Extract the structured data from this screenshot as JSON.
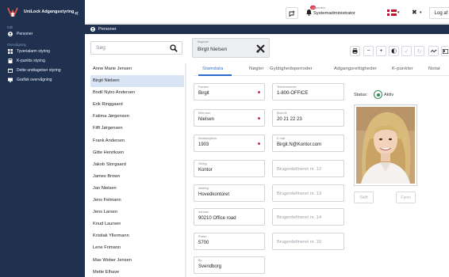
{
  "app": {
    "title": "UniLock Adgangsstyring"
  },
  "sidebar": {
    "section_edit": "Edit",
    "item_persons": "Personer",
    "section_overview": "Overvågning",
    "items": [
      {
        "label": "Tyverialarm styring",
        "icon": "grid-icon"
      },
      {
        "label": "K-punkts styring",
        "icon": "keypad-icon"
      },
      {
        "label": "Dette undtagelser styring",
        "icon": "calendar-icon"
      },
      {
        "label": "Grafisk overvågning",
        "icon": "monitor-icon"
      }
    ]
  },
  "topbar": {
    "notification_count": "16",
    "user_role": "Operator",
    "user_name": "Systemadministrator",
    "logout_label": "Log af"
  },
  "section": {
    "title": "Personer"
  },
  "list": {
    "search_placeholder": "Søg",
    "persons": [
      "Anne Marie Jensen",
      "Birgit Nielsen",
      "Bodil Nybo Andersen",
      "Erik Ringgaard",
      "Fatima Jørgensen",
      "Fiffi Jørgensen",
      "Frank Andersen",
      "Gitte Henriksen",
      "Jakob Storgaard",
      "James Brown",
      "Jan Nielsen",
      "Jens Felmann",
      "Jens Larsen",
      "Knud Laursen",
      "Kristiak Yllermann",
      "Lene Frimann",
      "Max Weber Jensen",
      "Mette Elhave"
    ],
    "selected_index": 1
  },
  "detail": {
    "selected_label": "Begeven",
    "selected_value": "Birgit Nielsen",
    "tabs": [
      "Stamdata",
      "Nøgler",
      "Gyldighedsperioder",
      "Adgangsrettigheder",
      "K-punkter",
      "Notat"
    ],
    "active_tab": 0,
    "fields": {
      "fornavn": {
        "label": "Fornavn",
        "value": "Birgit"
      },
      "efternavn": {
        "label": "Efternavn",
        "value": "Nielsen"
      },
      "medarbejdernr": {
        "label": "Medarbejdernr.",
        "value": "1903"
      },
      "stilling": {
        "label": "Stilling",
        "value": "Kontor"
      },
      "afdeling": {
        "label": "Afdeling",
        "value": "Hovedkontoret"
      },
      "adresse": {
        "label": "Adresse",
        "value": "90210 Office road"
      },
      "postnr": {
        "label": "Postnr.",
        "value": "5700"
      },
      "by": {
        "label": "By",
        "value": "Svendborg"
      },
      "telefon": {
        "label": "Telefonnummer",
        "value": "1-800-OFFICE"
      },
      "mobil": {
        "label": "Mobil tlf.",
        "value": "20 21 22 23"
      },
      "email": {
        "label": "E-mail",
        "value": "Birgit.N@Kontor.com"
      },
      "custom12": {
        "placeholder": "Brugerdefineret nr. 12"
      },
      "custom13": {
        "placeholder": "Brugerdefineret nr. 13"
      },
      "custom14": {
        "placeholder": "Brugerdefineret nr. 14"
      },
      "custom15": {
        "placeholder": "Brugerdefineret nr. 15"
      }
    },
    "status_label": "Status:",
    "status_value": "Aktiv",
    "photo_buttons": {
      "change": "Skift",
      "remove": "Fjern"
    }
  },
  "colors": {
    "sidebar_bg": "#20314f",
    "accent": "#2c6bc9",
    "selected_row": "#d9e4f4",
    "status_active": "#2e8b57",
    "required": "#d7263d",
    "badge": "#d7263d"
  }
}
